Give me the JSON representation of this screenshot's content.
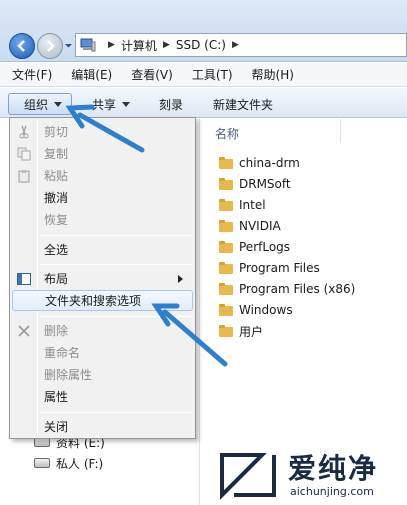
{
  "address_bar": {
    "path": [
      "计算机",
      "SSD (C:)"
    ]
  },
  "menubar": {
    "items": [
      "文件(F)",
      "编辑(E)",
      "查看(V)",
      "工具(T)",
      "帮助(H)"
    ]
  },
  "command_bar": {
    "organize": "组织",
    "share": "共享",
    "burn": "刻录",
    "new_folder": "新建文件夹"
  },
  "file_list": {
    "column_header": "名称",
    "folders": [
      "china-drm",
      "DRMSoft",
      "Intel",
      "NVIDIA",
      "PerfLogs",
      "Program Files",
      "Program Files (x86)",
      "Windows",
      "用户"
    ]
  },
  "nav_pane": {
    "drives": [
      "资料 (E:)",
      "私人 (F:)"
    ]
  },
  "organize_menu": {
    "items": [
      {
        "label": "剪切",
        "enabled": false,
        "icon": "scissors-icon"
      },
      {
        "label": "复制",
        "enabled": false,
        "icon": "copy-icon"
      },
      {
        "label": "粘贴",
        "enabled": false,
        "icon": "paste-icon"
      },
      {
        "label": "撤消",
        "enabled": true
      },
      {
        "label": "恢复",
        "enabled": false
      },
      {
        "label": "全选",
        "enabled": true
      },
      {
        "label": "布局",
        "enabled": true,
        "icon": "layout-icon",
        "submenu": true
      },
      {
        "label": "文件夹和搜索选项",
        "enabled": true,
        "highlighted": true
      },
      {
        "label": "删除",
        "enabled": false,
        "icon": "delete-x-icon"
      },
      {
        "label": "重命名",
        "enabled": false
      },
      {
        "label": "删除属性",
        "enabled": false
      },
      {
        "label": "属性",
        "enabled": true
      },
      {
        "label": "关闭",
        "enabled": true
      }
    ]
  },
  "watermark": {
    "title": "爱纯净",
    "url": "aichunjing.com"
  },
  "colors": {
    "accent_blue": "#1e5db8",
    "arrow_blue": "#2f7fd0",
    "menu_bg": "#f1f1f1",
    "folder_yellow": "#e8b94a"
  }
}
